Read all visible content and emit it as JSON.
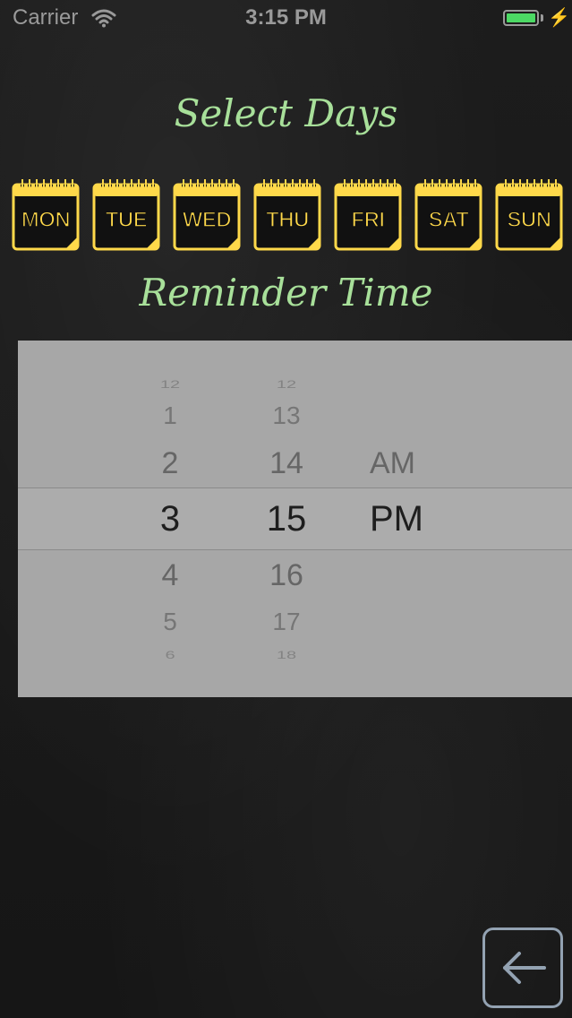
{
  "status_bar": {
    "carrier": "Carrier",
    "time": "3:15 PM",
    "wifi_icon": "wifi-icon",
    "battery_icon": "battery-icon",
    "charging_icon": "charging-bolt-icon",
    "battery_color": "#4cd964"
  },
  "titles": {
    "select_days": "Select Days",
    "reminder_time": "Reminder Time"
  },
  "days": [
    {
      "label": "MON",
      "icon": "calendar-icon"
    },
    {
      "label": "TUE",
      "icon": "calendar-icon"
    },
    {
      "label": "WED",
      "icon": "calendar-icon"
    },
    {
      "label": "THU",
      "icon": "calendar-icon"
    },
    {
      "label": "FRI",
      "icon": "calendar-icon"
    },
    {
      "label": "SAT",
      "icon": "calendar-icon"
    },
    {
      "label": "SUN",
      "icon": "calendar-icon"
    }
  ],
  "picker": {
    "hours": [
      "12",
      "1",
      "2",
      "3",
      "4",
      "5",
      "6"
    ],
    "minutes": [
      "12",
      "13",
      "14",
      "15",
      "16",
      "17",
      "18"
    ],
    "ampm": [
      "AM",
      "PM"
    ],
    "selected_hour": "3",
    "selected_minute": "15",
    "selected_ampm": "PM"
  },
  "back_button": {
    "icon": "back-arrow-icon"
  },
  "colors": {
    "title_green": "#a8e09a",
    "calendar_yellow": "#ffd94a",
    "picker_background": "#a7a7a7",
    "button_border": "#93a2b2"
  }
}
